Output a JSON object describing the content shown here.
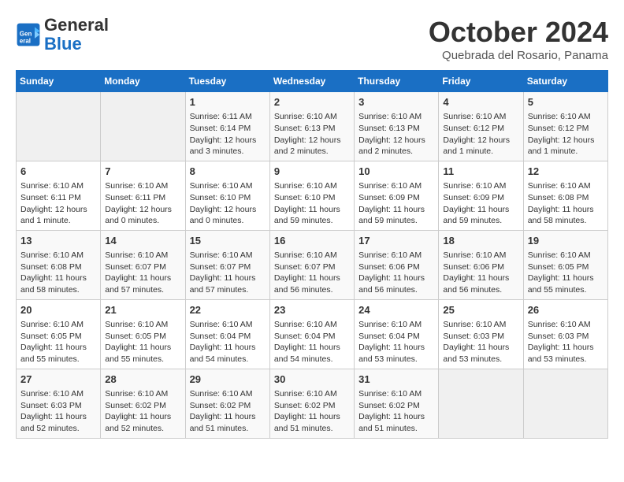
{
  "header": {
    "logo_general": "General",
    "logo_blue": "Blue",
    "month_title": "October 2024",
    "subtitle": "Quebrada del Rosario, Panama"
  },
  "days_of_week": [
    "Sunday",
    "Monday",
    "Tuesday",
    "Wednesday",
    "Thursday",
    "Friday",
    "Saturday"
  ],
  "weeks": [
    [
      {
        "day": "",
        "info": ""
      },
      {
        "day": "",
        "info": ""
      },
      {
        "day": "1",
        "info": "Sunrise: 6:11 AM\nSunset: 6:14 PM\nDaylight: 12 hours\nand 3 minutes."
      },
      {
        "day": "2",
        "info": "Sunrise: 6:10 AM\nSunset: 6:13 PM\nDaylight: 12 hours\nand 2 minutes."
      },
      {
        "day": "3",
        "info": "Sunrise: 6:10 AM\nSunset: 6:13 PM\nDaylight: 12 hours\nand 2 minutes."
      },
      {
        "day": "4",
        "info": "Sunrise: 6:10 AM\nSunset: 6:12 PM\nDaylight: 12 hours\nand 1 minute."
      },
      {
        "day": "5",
        "info": "Sunrise: 6:10 AM\nSunset: 6:12 PM\nDaylight: 12 hours\nand 1 minute."
      }
    ],
    [
      {
        "day": "6",
        "info": "Sunrise: 6:10 AM\nSunset: 6:11 PM\nDaylight: 12 hours\nand 1 minute."
      },
      {
        "day": "7",
        "info": "Sunrise: 6:10 AM\nSunset: 6:11 PM\nDaylight: 12 hours\nand 0 minutes."
      },
      {
        "day": "8",
        "info": "Sunrise: 6:10 AM\nSunset: 6:10 PM\nDaylight: 12 hours\nand 0 minutes."
      },
      {
        "day": "9",
        "info": "Sunrise: 6:10 AM\nSunset: 6:10 PM\nDaylight: 11 hours\nand 59 minutes."
      },
      {
        "day": "10",
        "info": "Sunrise: 6:10 AM\nSunset: 6:09 PM\nDaylight: 11 hours\nand 59 minutes."
      },
      {
        "day": "11",
        "info": "Sunrise: 6:10 AM\nSunset: 6:09 PM\nDaylight: 11 hours\nand 59 minutes."
      },
      {
        "day": "12",
        "info": "Sunrise: 6:10 AM\nSunset: 6:08 PM\nDaylight: 11 hours\nand 58 minutes."
      }
    ],
    [
      {
        "day": "13",
        "info": "Sunrise: 6:10 AM\nSunset: 6:08 PM\nDaylight: 11 hours\nand 58 minutes."
      },
      {
        "day": "14",
        "info": "Sunrise: 6:10 AM\nSunset: 6:07 PM\nDaylight: 11 hours\nand 57 minutes."
      },
      {
        "day": "15",
        "info": "Sunrise: 6:10 AM\nSunset: 6:07 PM\nDaylight: 11 hours\nand 57 minutes."
      },
      {
        "day": "16",
        "info": "Sunrise: 6:10 AM\nSunset: 6:07 PM\nDaylight: 11 hours\nand 56 minutes."
      },
      {
        "day": "17",
        "info": "Sunrise: 6:10 AM\nSunset: 6:06 PM\nDaylight: 11 hours\nand 56 minutes."
      },
      {
        "day": "18",
        "info": "Sunrise: 6:10 AM\nSunset: 6:06 PM\nDaylight: 11 hours\nand 56 minutes."
      },
      {
        "day": "19",
        "info": "Sunrise: 6:10 AM\nSunset: 6:05 PM\nDaylight: 11 hours\nand 55 minutes."
      }
    ],
    [
      {
        "day": "20",
        "info": "Sunrise: 6:10 AM\nSunset: 6:05 PM\nDaylight: 11 hours\nand 55 minutes."
      },
      {
        "day": "21",
        "info": "Sunrise: 6:10 AM\nSunset: 6:05 PM\nDaylight: 11 hours\nand 55 minutes."
      },
      {
        "day": "22",
        "info": "Sunrise: 6:10 AM\nSunset: 6:04 PM\nDaylight: 11 hours\nand 54 minutes."
      },
      {
        "day": "23",
        "info": "Sunrise: 6:10 AM\nSunset: 6:04 PM\nDaylight: 11 hours\nand 54 minutes."
      },
      {
        "day": "24",
        "info": "Sunrise: 6:10 AM\nSunset: 6:04 PM\nDaylight: 11 hours\nand 53 minutes."
      },
      {
        "day": "25",
        "info": "Sunrise: 6:10 AM\nSunset: 6:03 PM\nDaylight: 11 hours\nand 53 minutes."
      },
      {
        "day": "26",
        "info": "Sunrise: 6:10 AM\nSunset: 6:03 PM\nDaylight: 11 hours\nand 53 minutes."
      }
    ],
    [
      {
        "day": "27",
        "info": "Sunrise: 6:10 AM\nSunset: 6:03 PM\nDaylight: 11 hours\nand 52 minutes."
      },
      {
        "day": "28",
        "info": "Sunrise: 6:10 AM\nSunset: 6:02 PM\nDaylight: 11 hours\nand 52 minutes."
      },
      {
        "day": "29",
        "info": "Sunrise: 6:10 AM\nSunset: 6:02 PM\nDaylight: 11 hours\nand 51 minutes."
      },
      {
        "day": "30",
        "info": "Sunrise: 6:10 AM\nSunset: 6:02 PM\nDaylight: 11 hours\nand 51 minutes."
      },
      {
        "day": "31",
        "info": "Sunrise: 6:10 AM\nSunset: 6:02 PM\nDaylight: 11 hours\nand 51 minutes."
      },
      {
        "day": "",
        "info": ""
      },
      {
        "day": "",
        "info": ""
      }
    ]
  ]
}
